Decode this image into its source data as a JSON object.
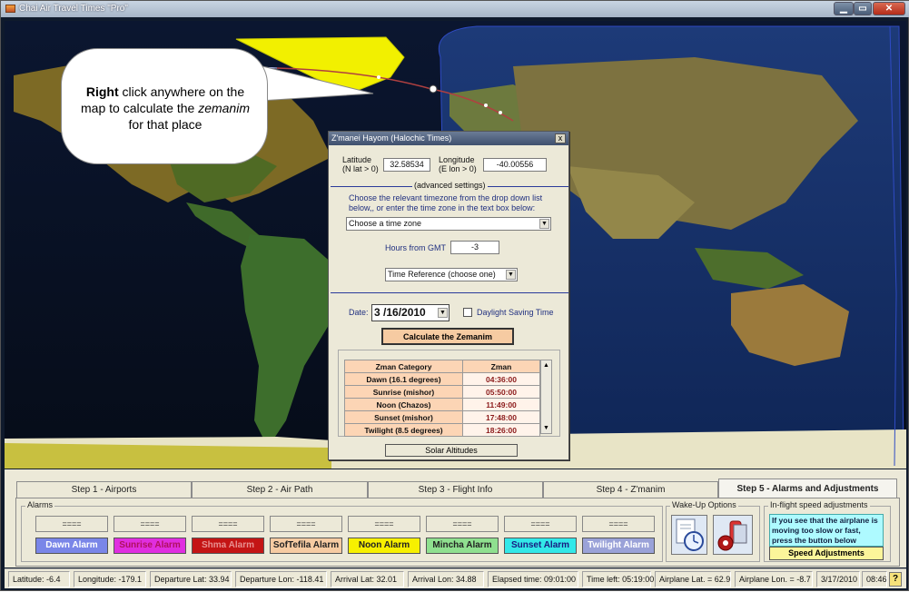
{
  "window": {
    "title": "Chai Air Travel Times \"Pro\"",
    "min": "▁",
    "max": "▭",
    "close": "✕"
  },
  "callout": {
    "bold": "Right",
    "rest": " click anywhere on the map to calculate the ",
    "em": "zemanim",
    "tail": " for that place"
  },
  "dialog": {
    "title": "Z'manei Hayom (Halochic Times)",
    "close": "x",
    "lat_label1": "Latitude",
    "lat_label2": "(N lat > 0)",
    "lat_value": "32.58534",
    "lon_label1": "Longitude",
    "lon_label2": "(E lon > 0)",
    "lon_value": "-40.00556",
    "advanced": "(advanced settings)",
    "tz_instructions": "Choose the relevant timezone from the drop down list below,, or enter the time zone in the text box below:",
    "tz_combo": "Choose a time zone",
    "gmt_label": "Hours from GMT",
    "gmt_value": "-3",
    "timeref_combo": "Time Reference (choose one)",
    "date_label": "Date:",
    "date_value": "3 /16/2010",
    "dst_label": "Daylight Saving Time",
    "calc_button": "Calculate the Zemanim",
    "table_headers": [
      "Zman Category",
      "Zman"
    ],
    "rows": [
      {
        "cat": "Dawn (16.1 degrees)",
        "time": "04:36:00"
      },
      {
        "cat": "Sunrise (mishor)",
        "time": "05:50:00"
      },
      {
        "cat": "Noon (Chazos)",
        "time": "11:49:00"
      },
      {
        "cat": "Sunset (mishor)",
        "time": "17:48:00"
      },
      {
        "cat": "Twilight (8.5 degrees)",
        "time": "18:26:00"
      }
    ],
    "solar_button": "Solar Altitudes"
  },
  "tabs": [
    {
      "label": "Step 1 - Airports"
    },
    {
      "label": "Step 2 - Air Path"
    },
    {
      "label": "Step 3 - Flight Info"
    },
    {
      "label": "Step 4 - Z'manim"
    },
    {
      "label": "Step 5 - Alarms and Adjustments"
    }
  ],
  "alarms": {
    "group_label": "Alarms",
    "displays": [
      "====",
      "====",
      "====",
      "====",
      "====",
      "====",
      "====",
      "===="
    ],
    "buttons": [
      {
        "label": "Dawn Alarm",
        "color": "#7a86e8",
        "text_color": "#ffffff"
      },
      {
        "label": "Sunrise Alarm",
        "color": "#e02ee0",
        "text_color": "#b01060"
      },
      {
        "label": "Shma Alarm",
        "color": "#c41414",
        "text_color": "#e89090"
      },
      {
        "label": "SofTefila Alarm",
        "color": "#f6cba2",
        "text_color": "#222222"
      },
      {
        "label": "Noon Alarm",
        "color": "#f7f000",
        "text_color": "#222222"
      },
      {
        "label": "Mincha Alarm",
        "color": "#8fe08f",
        "text_color": "#222222"
      },
      {
        "label": "Sunset Alarm",
        "color": "#32e8e8",
        "text_color": "#1a1a80"
      },
      {
        "label": "Twilight Alarm",
        "color": "#9aa2d8",
        "text_color": "#ffffff"
      }
    ]
  },
  "wakeup": {
    "label": "Wake-Up Options"
  },
  "speed": {
    "label": "In-flight speed adjustments",
    "text": "If you see that the airplane is moving too slow or fast, press the button below",
    "button": "Speed Adjustments"
  },
  "status": [
    "Latitude: -6.4",
    "Longitude: -179.1",
    "Departure Lat: 33.94",
    "Departure Lon: -118.41",
    "Arrival Lat: 32.01",
    "Arrival Lon: 34.88",
    "Elapsed time: 09:01:00",
    "Time left: 05:19:00",
    "Airplane Lat. = 62.9",
    "Airplane Lon. = -8.7",
    "3/17/2010",
    "08:46"
  ],
  "help_icon": "?"
}
